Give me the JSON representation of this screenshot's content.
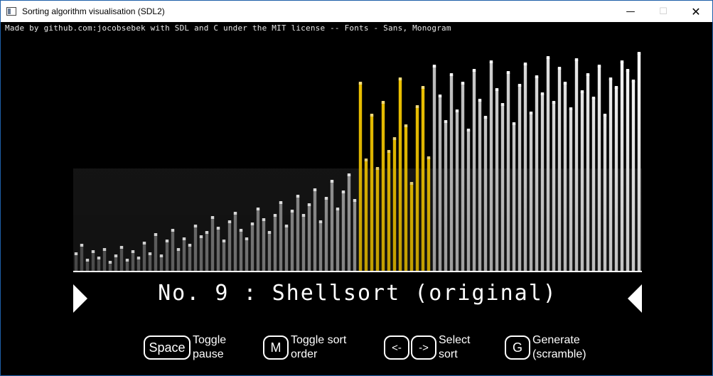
{
  "window": {
    "title": "Sorting algorithm visualisation (SDL2)",
    "minimize_icon": "minimize-icon",
    "maximize_icon": "maximize-icon",
    "close_icon": "close-icon",
    "minimize_glyph": "—",
    "maximize_glyph": "☐",
    "close_glyph": "✕"
  },
  "credits": "Made by github.com:jocobsebek with SDL and C under the MIT license -- Fonts - Sans, Monogram",
  "algorithm": {
    "title": "No. 9 : Shellsort (original)",
    "prev_icon": "triangle-right-icon",
    "next_icon": "triangle-left-icon"
  },
  "controls": [
    {
      "key": "Space",
      "label": "Toggle\npause"
    },
    {
      "key": "M",
      "label": "Toggle sort\norder"
    },
    {
      "keys": [
        "<-",
        "->"
      ],
      "label": "Select\nsort"
    },
    {
      "key": "G",
      "label": "Generate\n(scramble)"
    }
  ],
  "chart_data": {
    "type": "bar",
    "value_range": [
      0,
      1
    ],
    "highlight_color": "#f5c800",
    "bar_color": "#ffffff",
    "highlight_range": [
      50,
      62
    ],
    "values": [
      0.08,
      0.12,
      0.05,
      0.09,
      0.06,
      0.1,
      0.04,
      0.07,
      0.11,
      0.05,
      0.09,
      0.06,
      0.13,
      0.08,
      0.17,
      0.07,
      0.14,
      0.19,
      0.1,
      0.15,
      0.12,
      0.21,
      0.16,
      0.18,
      0.25,
      0.2,
      0.14,
      0.23,
      0.27,
      0.19,
      0.15,
      0.22,
      0.29,
      0.24,
      0.18,
      0.26,
      0.32,
      0.21,
      0.28,
      0.35,
      0.26,
      0.31,
      0.38,
      0.23,
      0.34,
      0.42,
      0.29,
      0.37,
      0.45,
      0.33,
      0.88,
      0.52,
      0.73,
      0.48,
      0.79,
      0.56,
      0.62,
      0.9,
      0.68,
      0.41,
      0.77,
      0.86,
      0.53,
      0.96,
      0.82,
      0.7,
      0.92,
      0.75,
      0.88,
      0.66,
      0.94,
      0.8,
      0.72,
      0.98,
      0.85,
      0.78,
      0.93,
      0.69,
      0.87,
      0.97,
      0.74,
      0.91,
      0.83,
      1.0,
      0.79,
      0.95,
      0.88,
      0.76,
      0.99,
      0.84,
      0.92,
      0.81,
      0.96,
      0.73,
      0.9,
      0.86,
      0.98,
      0.94,
      0.89,
      1.02
    ]
  }
}
